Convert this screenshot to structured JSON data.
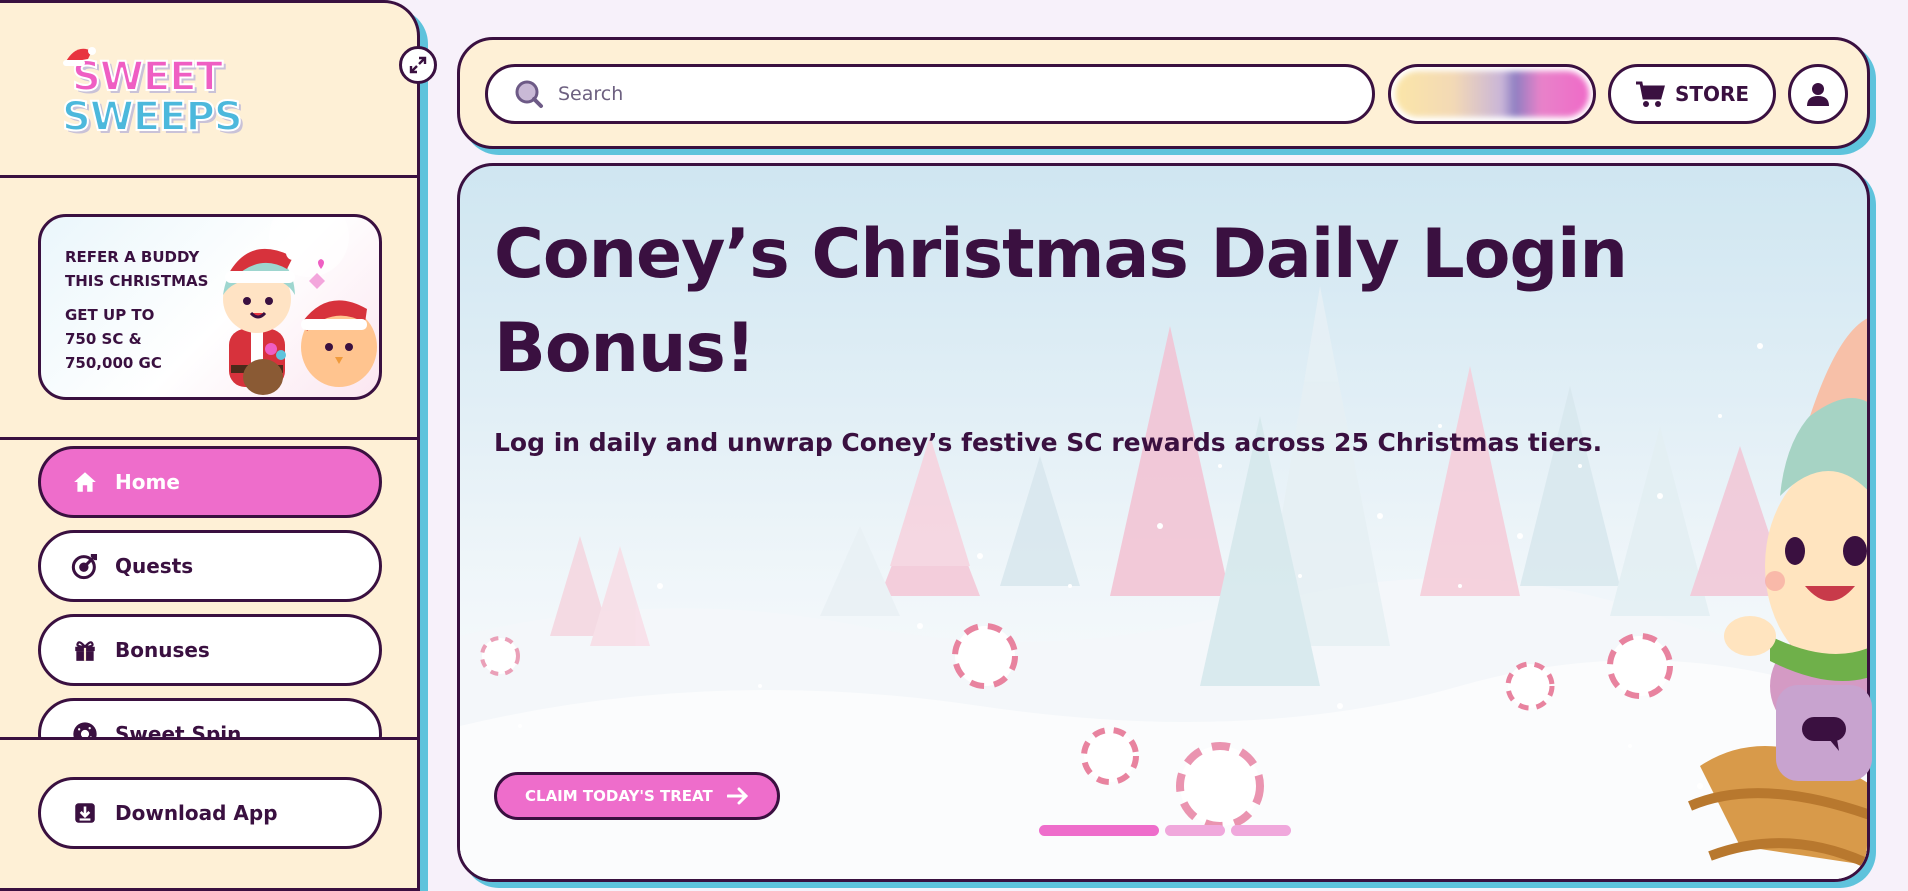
{
  "brand": {
    "logo_line1": "SWEET",
    "logo_line2": "SWEEPS"
  },
  "sidebar": {
    "promo": {
      "line1": "REFER A BUDDY",
      "line2": "THIS CHRISTMAS",
      "line3": "GET UP TO",
      "line4": "750 SC &",
      "line5": "750,000 GC"
    },
    "nav_items": [
      {
        "label": "Home",
        "icon": "home-icon",
        "active": true
      },
      {
        "label": "Quests",
        "icon": "quest-target-icon",
        "active": false
      },
      {
        "label": "Bonuses",
        "icon": "gift-icon",
        "active": false
      },
      {
        "label": "Sweet Spin",
        "icon": "donut-icon",
        "active": false
      }
    ],
    "download_label": "Download App"
  },
  "topbar": {
    "search_placeholder": "Search",
    "store_label": "STORE"
  },
  "hero": {
    "title": "Coney’s Christmas Daily Login Bonus!",
    "subtitle": "Log in daily and unwrap Coney’s festive SC rewards across 25 Christmas tiers.",
    "cta_label": "CLAIM TODAY'S TREAT",
    "slide_count": 3,
    "active_slide": 1
  },
  "colors": {
    "ink": "#3a1040",
    "pink": "#ee6dcb",
    "cream": "#fef0d6",
    "cyan_shadow": "#5ec3dc",
    "lilac": "#c8a3cf"
  }
}
